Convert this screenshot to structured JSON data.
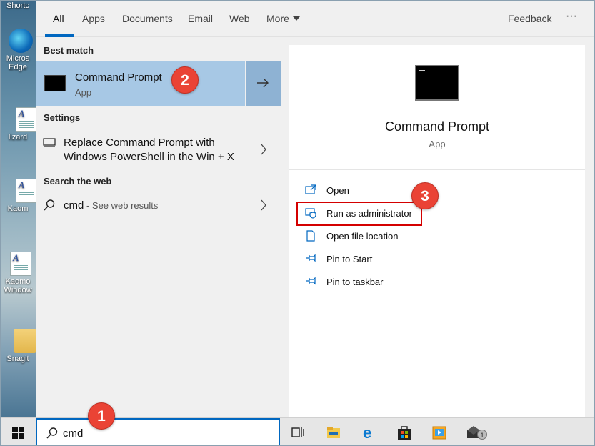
{
  "tabs": [
    {
      "label": "All",
      "active": true
    },
    {
      "label": "Apps"
    },
    {
      "label": "Documents"
    },
    {
      "label": "Email"
    },
    {
      "label": "Web"
    },
    {
      "label": "More"
    }
  ],
  "header": {
    "feedback": "Feedback",
    "more_options": "···"
  },
  "results": {
    "best_match_label": "Best match",
    "best_match": {
      "title": "Command Prompt",
      "subtitle": "App"
    },
    "settings_label": "Settings",
    "settings_item_line1": "Replace Command Prompt with",
    "settings_item_line2": "Windows PowerShell in the Win + X",
    "web_label": "Search the web",
    "web_query": "cmd",
    "web_suffix": " - See web results"
  },
  "preview": {
    "title": "Command Prompt",
    "subtitle": "App",
    "actions": [
      {
        "label": "Open",
        "icon": "open-icon"
      },
      {
        "label": "Run as administrator",
        "icon": "shield-icon"
      },
      {
        "label": "Open file location",
        "icon": "file-location-icon"
      },
      {
        "label": "Pin to Start",
        "icon": "pin-icon"
      },
      {
        "label": "Pin to taskbar",
        "icon": "pin-icon"
      }
    ]
  },
  "callouts": [
    "1",
    "2",
    "3"
  ],
  "search": {
    "value": "cmd"
  },
  "desktop": {
    "icons": [
      "Shortc",
      "Micros Edge",
      "lizard",
      "Kaom",
      "Kaomo Window",
      "Snagit"
    ]
  },
  "taskbar": {
    "mail_badge": "1"
  },
  "colors": {
    "accent": "#0067c0",
    "best_match_bg": "#a7c8e5",
    "callout": "#ea4335",
    "highlight": "#d40000"
  }
}
